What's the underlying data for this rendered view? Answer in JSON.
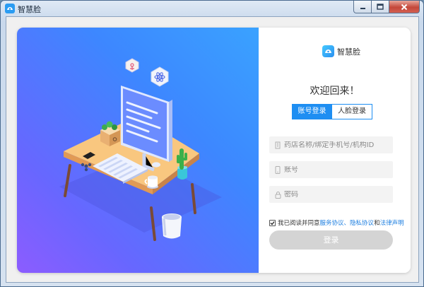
{
  "window": {
    "title": "智慧脸",
    "icon": "app-logo-icon",
    "controls": [
      "minimize-icon",
      "maximize-icon",
      "close-icon"
    ]
  },
  "brand": {
    "name": "智慧脸",
    "logo_color": "#2b8ff0"
  },
  "welcome": "欢迎回来！",
  "tabs": [
    {
      "label": "账号登录",
      "active": true
    },
    {
      "label": "人脸登录",
      "active": false
    }
  ],
  "form": {
    "store": {
      "placeholder": "药店名称/绑定手机号/机构ID",
      "value": "",
      "icon": "building-icon"
    },
    "account": {
      "placeholder": "账号",
      "value": "",
      "icon": "phone-icon"
    },
    "password": {
      "placeholder": "密码",
      "value": "",
      "icon": "lock-icon"
    }
  },
  "agreement": {
    "checked": true,
    "prefix": "我已阅读并同意",
    "service": "服务协议",
    "sep1": "、",
    "privacy": "隐私协议",
    "sep2": "和",
    "legal": "法律声明"
  },
  "login_label": "登录",
  "colors": {
    "accent": "#1e8ef2",
    "hero_start": "#3aa2ff",
    "hero_end": "#8c5cff",
    "button_disabled": "#d4d4d4"
  }
}
